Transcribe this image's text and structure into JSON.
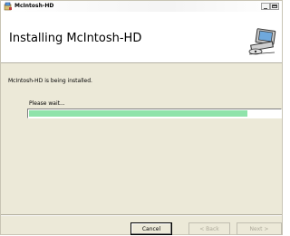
{
  "window": {
    "title": "McIntosh-HD",
    "minimize_icon": "minimize-icon",
    "maximize_icon": "maximize-icon"
  },
  "banner": {
    "title": "Installing McIntosh-HD",
    "icon": "computer-install-icon"
  },
  "body": {
    "status_text": "McIntosh-HD is being installed.",
    "wait_text": "Please wait..."
  },
  "progress": {
    "fraction": 0.87,
    "color": "#8fe3aa"
  },
  "buttons": {
    "cancel_label": "Cancel",
    "back_label": "< Back",
    "next_label": "Next >"
  }
}
